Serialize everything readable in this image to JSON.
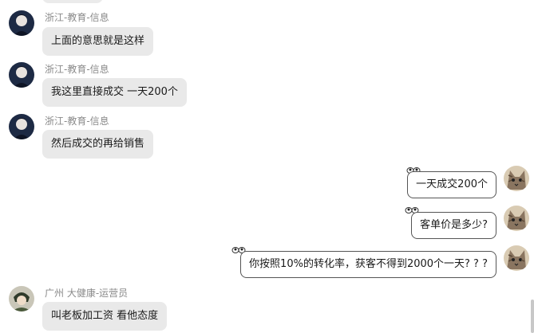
{
  "messages": [
    {
      "side": "left",
      "sender": "浙江-教育-信息",
      "text": "上面的意思就是这样",
      "avatar": "avatar-dark-portrait"
    },
    {
      "side": "left",
      "sender": "浙江-教育-信息",
      "text": "我这里直接成交 一天200个",
      "avatar": "avatar-dark-portrait"
    },
    {
      "side": "left",
      "sender": "浙江-教育-信息",
      "text": "然后成交的再给销售",
      "avatar": "avatar-dark-portrait"
    },
    {
      "side": "right",
      "text": "一天成交200个",
      "avatar": "avatar-cat"
    },
    {
      "side": "right",
      "text": "客单价是多少?",
      "avatar": "avatar-cat"
    },
    {
      "side": "right",
      "text": "你按照10%的转化率，获客不得到2000个一天? ? ?",
      "avatar": "avatar-cat"
    },
    {
      "side": "left",
      "sender": "广州 大健康-运营员",
      "text": "叫老板加工资 看他态度",
      "avatar": "avatar-anime-character"
    }
  ]
}
